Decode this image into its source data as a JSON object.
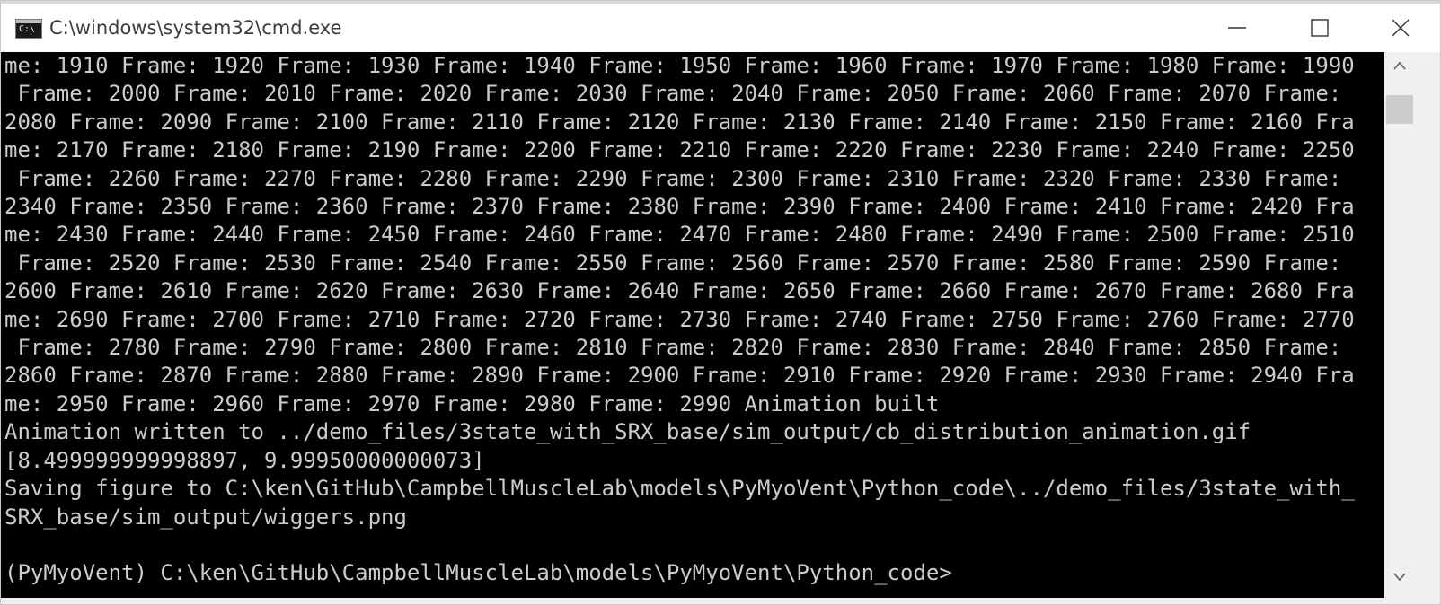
{
  "window": {
    "title": "C:\\windows\\system32\\cmd.exe",
    "icon": "cmd-console-icon",
    "controls": {
      "minimize_icon": "minimize-icon",
      "maximize_icon": "maximize-icon",
      "close_icon": "close-icon"
    }
  },
  "console": {
    "background": "#000000",
    "foreground": "#cccccc",
    "lines": [
      "me: 1910 Frame: 1920 Frame: 1930 Frame: 1940 Frame: 1950 Frame: 1960 Frame: 1970 Frame: 1980 Frame: 1990",
      " Frame: 2000 Frame: 2010 Frame: 2020 Frame: 2030 Frame: 2040 Frame: 2050 Frame: 2060 Frame: 2070 Frame:",
      "2080 Frame: 2090 Frame: 2100 Frame: 2110 Frame: 2120 Frame: 2130 Frame: 2140 Frame: 2150 Frame: 2160 Fra",
      "me: 2170 Frame: 2180 Frame: 2190 Frame: 2200 Frame: 2210 Frame: 2220 Frame: 2230 Frame: 2240 Frame: 2250",
      " Frame: 2260 Frame: 2270 Frame: 2280 Frame: 2290 Frame: 2300 Frame: 2310 Frame: 2320 Frame: 2330 Frame:",
      "2340 Frame: 2350 Frame: 2360 Frame: 2370 Frame: 2380 Frame: 2390 Frame: 2400 Frame: 2410 Frame: 2420 Fra",
      "me: 2430 Frame: 2440 Frame: 2450 Frame: 2460 Frame: 2470 Frame: 2480 Frame: 2490 Frame: 2500 Frame: 2510",
      " Frame: 2520 Frame: 2530 Frame: 2540 Frame: 2550 Frame: 2560 Frame: 2570 Frame: 2580 Frame: 2590 Frame:",
      "2600 Frame: 2610 Frame: 2620 Frame: 2630 Frame: 2640 Frame: 2650 Frame: 2660 Frame: 2670 Frame: 2680 Fra",
      "me: 2690 Frame: 2700 Frame: 2710 Frame: 2720 Frame: 2730 Frame: 2740 Frame: 2750 Frame: 2760 Frame: 2770",
      " Frame: 2780 Frame: 2790 Frame: 2800 Frame: 2810 Frame: 2820 Frame: 2830 Frame: 2840 Frame: 2850 Frame:",
      "2860 Frame: 2870 Frame: 2880 Frame: 2890 Frame: 2900 Frame: 2910 Frame: 2920 Frame: 2930 Frame: 2940 Fra",
      "me: 2950 Frame: 2960 Frame: 2970 Frame: 2980 Frame: 2990 Animation built",
      "Animation written to ../demo_files/3state_with_SRX_base/sim_output/cb_distribution_animation.gif",
      "[8.499999999998897, 9.99950000000073]",
      "Saving figure to C:\\ken\\GitHub\\CampbellMuscleLab\\models\\PyMyoVent\\Python_code\\../demo_files/3state_with_",
      "SRX_base/sim_output/wiggers.png",
      "",
      "(PyMyoVent) C:\\ken\\GitHub\\CampbellMuscleLab\\models\\PyMyoVent\\Python_code>"
    ]
  },
  "scrollbar": {
    "up_icon": "scroll-up-arrow-icon",
    "down_icon": "scroll-down-arrow-icon"
  }
}
